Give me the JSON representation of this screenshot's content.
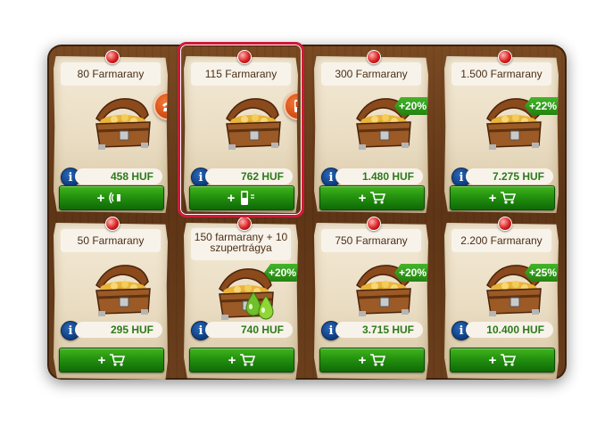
{
  "offers": [
    {
      "title": "80 Farmarany",
      "price": "458 HUF",
      "method": "phone",
      "bonus": ""
    },
    {
      "title": "115 Farmarany",
      "price": "762 HUF",
      "method": "sms",
      "bonus": ""
    },
    {
      "title": "300 Farmarany",
      "price": "1.480 HUF",
      "method": "cart",
      "bonus": "+20%"
    },
    {
      "title": "1.500 Farmarany",
      "price": "7.275 HUF",
      "method": "cart",
      "bonus": "+22%"
    },
    {
      "title": "50 Farmarany",
      "price": "295 HUF",
      "method": "cart",
      "bonus": ""
    },
    {
      "title": "150 farmarany + 10 szupertrágya",
      "price": "740 HUF",
      "method": "cart",
      "bonus": "+20%"
    },
    {
      "title": "750 Farmarany",
      "price": "3.715 HUF",
      "method": "cart",
      "bonus": "+20%"
    },
    {
      "title": "2.200 Farmarany",
      "price": "10.400 HUF",
      "method": "cart",
      "bonus": "+25%"
    }
  ],
  "info_label": "i",
  "buy_plus": "+",
  "icons": {
    "phone": "phone-icon",
    "sms": "mobile-sms-icon",
    "cart": "shopping-cart-icon",
    "fertilizer": "fertilizer-drops-icon",
    "chest": "gold-chest-icon"
  },
  "colors": {
    "price_green": "#2d7a1a",
    "button_green": "#1f8a0d",
    "bonus_green": "#23820f",
    "selected_border": "#d01a3a",
    "call_badge": "#d0470f",
    "info_blue": "#0e3b7c"
  },
  "selected_index": 1
}
